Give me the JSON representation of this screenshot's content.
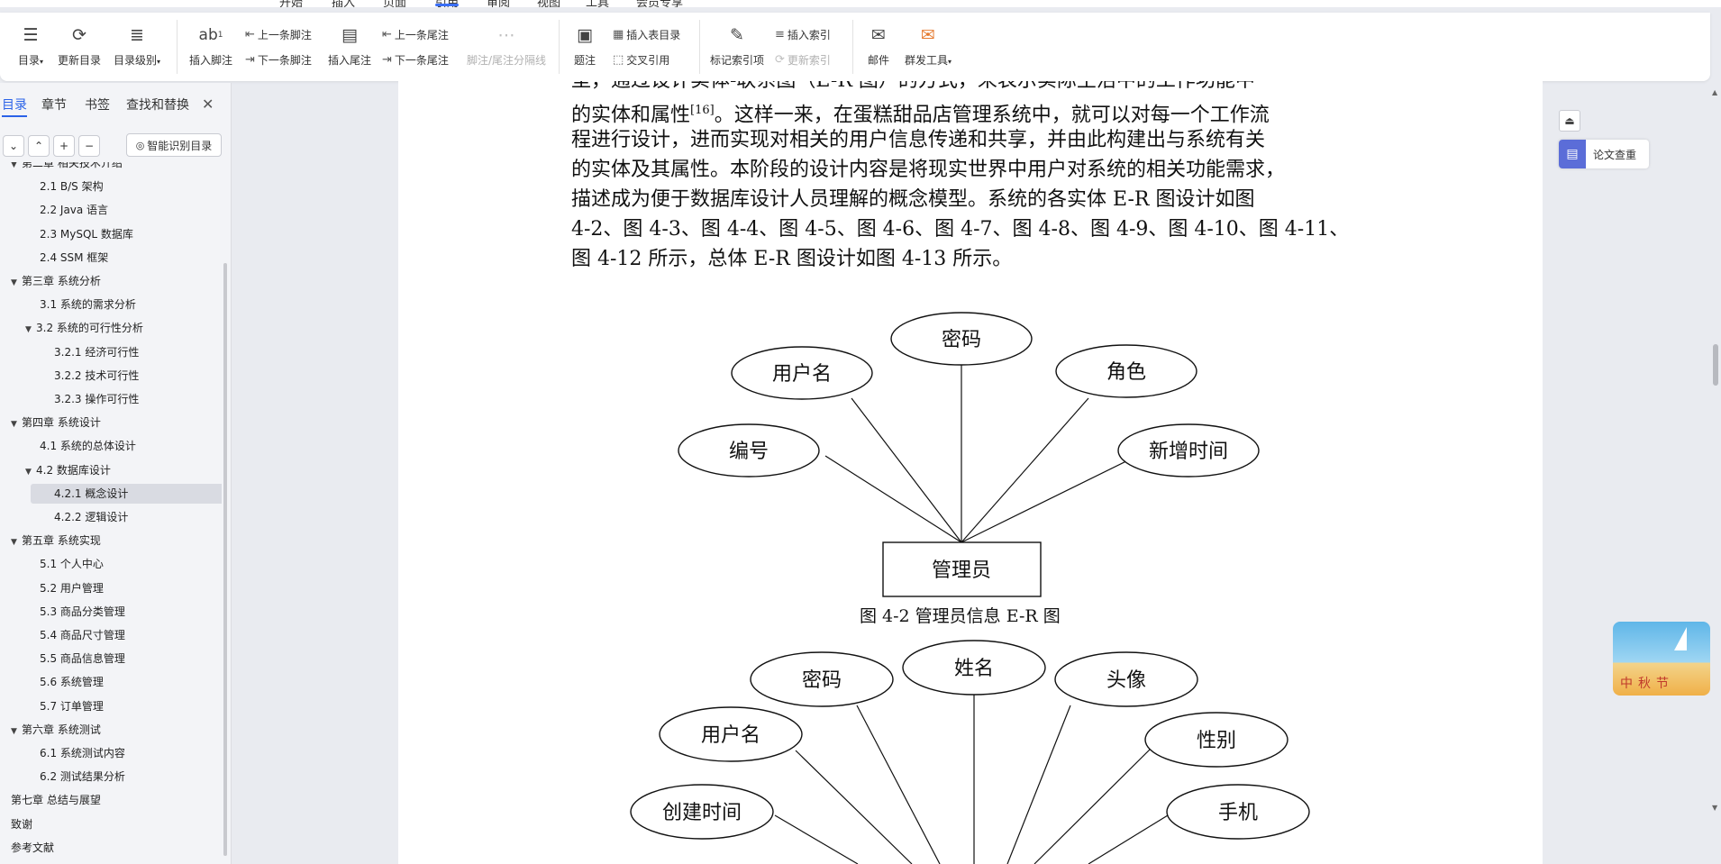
{
  "topbar": {
    "menu_items": [
      "开始",
      "插入",
      "页面",
      "引用",
      "审阅",
      "视图",
      "工具",
      "会员专享"
    ],
    "active_menu": "引用"
  },
  "ribbon": {
    "toc": "目录",
    "update_toc": "更新目录",
    "toc_level": "目录级别",
    "insert_footnote": "插入脚注",
    "prev_footnote": "上一条脚注",
    "next_footnote": "下一条脚注",
    "insert_endnote": "插入尾注",
    "prev_endnote": "上一条尾注",
    "next_endnote": "下一条尾注",
    "separator": "脚注/尾注分隔线",
    "caption": "题注",
    "insert_table_of_figures": "插入表目录",
    "cross_reference": "交叉引用",
    "mark_index": "标记索引项",
    "insert_index": "插入索引",
    "update_index": "更新索引",
    "mail": "邮件",
    "mass_tool": "群发工具"
  },
  "nav": {
    "tabs": [
      "目录",
      "章节",
      "书签",
      "查找和替换"
    ],
    "smart_toc": "智能识别目录",
    "items": [
      {
        "text": "第二章  相关技术介绍",
        "level": 0,
        "arrow": "down"
      },
      {
        "text": "2.1 B/S 架构",
        "level": 1
      },
      {
        "text": "2.2 Java 语言",
        "level": 1
      },
      {
        "text": "2.3 MySQL 数据库",
        "level": 1
      },
      {
        "text": "2.4 SSM 框架",
        "level": 1
      },
      {
        "text": "第三章  系统分析",
        "level": 0,
        "arrow": "down"
      },
      {
        "text": "3.1 系统的需求分析",
        "level": 1
      },
      {
        "text": "3.2 系统的可行性分析",
        "level": 1,
        "arrow": "down"
      },
      {
        "text": "3.2.1 经济可行性",
        "level": 2
      },
      {
        "text": "3.2.2 技术可行性",
        "level": 2
      },
      {
        "text": "3.2.3 操作可行性",
        "level": 2
      },
      {
        "text": "第四章  系统设计",
        "level": 0,
        "arrow": "down"
      },
      {
        "text": "4.1 系统的总体设计",
        "level": 1
      },
      {
        "text": "4.2 数据库设计",
        "level": 1,
        "arrow": "down"
      },
      {
        "text": "4.2.1 概念设计",
        "level": 2,
        "selected": true
      },
      {
        "text": "4.2.2 逻辑设计",
        "level": 2
      },
      {
        "text": "第五章  系统实现",
        "level": 0,
        "arrow": "down"
      },
      {
        "text": "5.1 个人中心",
        "level": 1
      },
      {
        "text": "5.2 用户管理",
        "level": 1
      },
      {
        "text": "5.3 商品分类管理",
        "level": 1
      },
      {
        "text": "5.4 商品尺寸管理",
        "level": 1
      },
      {
        "text": "5.5 商品信息管理",
        "level": 1
      },
      {
        "text": "5.6 系统管理",
        "level": 1
      },
      {
        "text": "5.7 订单管理",
        "level": 1
      },
      {
        "text": "第六章  系统测试",
        "level": 0,
        "arrow": "down"
      },
      {
        "text": "6.1 系统测试内容",
        "level": 1
      },
      {
        "text": "6.2 测试结果分析",
        "level": 1
      },
      {
        "text": "第七章  总结与展望",
        "level": 0
      },
      {
        "text": "致谢",
        "level": 0
      },
      {
        "text": "参考文献",
        "level": 0
      }
    ]
  },
  "document": {
    "lines": [
      "型，通过设计实体-联系图（E-R 图）的方式，来表示实际生活中的工作功能中",
      "的实体和属性",
      "程进行设计，进而实现对相关的用户信息传递和共享，并由此构建出与系统有关",
      "的实体及其属性。本阶段的设计内容是将现实世界中用户对系统的相关功能需求，",
      "描述成为便于数据库设计人员理解的概念模型。系统的各实体 E-R 图设计如图",
      "4-2、图 4-3、图 4-4、图 4-5、图 4-6、图 4-7、图 4-8、图 4-9、图 4-10、图 4-11、",
      "图 4-12 所示，总体 E-R 图设计如图 4-13 所示。"
    ],
    "citation": "[16]",
    "line2_rest": "。这样一来，在蛋糕甜品店管理系统中，就可以对每一个工作流",
    "er1": {
      "entity": "管理员",
      "attributes": [
        "密码",
        "用户名",
        "角色",
        "编号",
        "新增时间"
      ]
    },
    "caption1": "图 4-2 管理员信息 E-R 图",
    "er2": {
      "attributes": [
        "姓名",
        "密码",
        "头像",
        "用户名",
        "性别",
        "创建时间",
        "手机"
      ]
    }
  },
  "right_panel": {
    "paper_check": "论文查重",
    "promo_text": "中秋节"
  },
  "colors": {
    "accent": "#2a62e8",
    "selected_item": "#d9dbe2",
    "app_bg": "#e9ebf0"
  }
}
